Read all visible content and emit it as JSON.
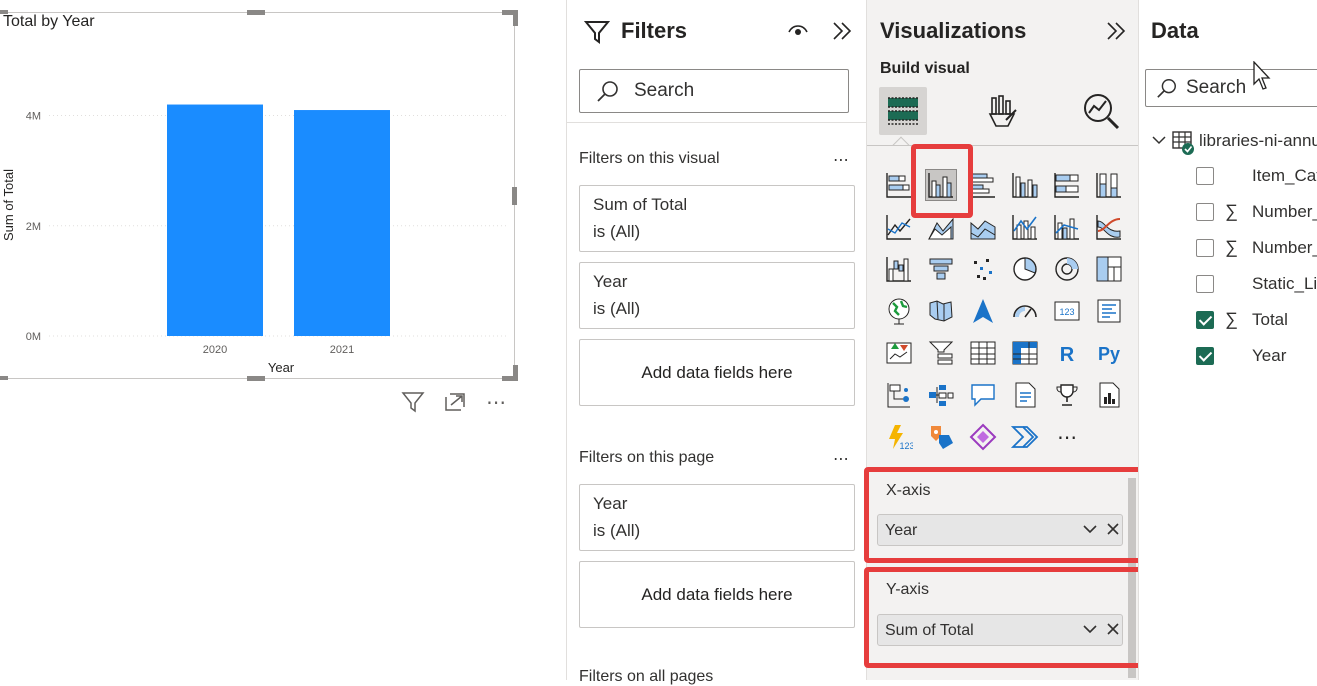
{
  "visual": {
    "title": "Total by Year",
    "header_icons": [
      "filter-icon",
      "focus-mode-icon",
      "more-options-icon"
    ],
    "more_glyph": "⋯"
  },
  "chart_data": {
    "type": "bar",
    "categories": [
      "2020",
      "2021"
    ],
    "values": [
      4200000,
      4100000
    ],
    "ylim": [
      0,
      4500000
    ],
    "yticks": [
      {
        "v": 0,
        "label": "0M"
      },
      {
        "v": 2000000,
        "label": "2M"
      },
      {
        "v": 4000000,
        "label": "4M"
      }
    ],
    "xlabel": "Year",
    "ylabel": "Sum of Total",
    "bar_color": "#1a8cff",
    "grid": true
  },
  "filters": {
    "title": "Filters",
    "search_placeholder": "Search",
    "more_glyph": "⋯",
    "on_visual": {
      "label": "Filters on this visual",
      "cards": [
        {
          "name": "Sum of Total",
          "state": "is (All)"
        },
        {
          "name": "Year",
          "state": "is (All)"
        }
      ],
      "add_label": "Add data fields here"
    },
    "on_page": {
      "label": "Filters on this page",
      "cards": [
        {
          "name": "Year",
          "state": "is (All)"
        }
      ],
      "add_label": "Add data fields here"
    },
    "on_all_pages": {
      "label": "Filters on all pages"
    }
  },
  "visualizations": {
    "title": "Visualizations",
    "subtitle": "Build visual",
    "tabs": [
      "build-visual-tab",
      "format-visual-tab",
      "analytics-tab"
    ],
    "more_glyph": "⋯",
    "selected_visual": "clustered-column-chart",
    "wells": [
      {
        "label": "X-axis",
        "field": "Year"
      },
      {
        "label": "Y-axis",
        "field": "Sum of Total"
      }
    ],
    "glyphs": {
      "r": "R",
      "py": "Py",
      "num": "123",
      "chevron": "∨",
      "close": "✕"
    },
    "accent": "#e63d3d"
  },
  "data": {
    "title": "Data",
    "search_placeholder": "Search",
    "table": {
      "name": "libraries-ni-annual"
    },
    "fields": [
      {
        "name": "Item_Category",
        "sum": false,
        "checked": false
      },
      {
        "name": "Number_of_Items",
        "sum": true,
        "checked": false
      },
      {
        "name": "Number_of_Loans",
        "sum": true,
        "checked": false
      },
      {
        "name": "Static_Library",
        "sum": false,
        "checked": false
      },
      {
        "name": "Total",
        "sum": true,
        "checked": true
      },
      {
        "name": "Year",
        "sum": false,
        "checked": true
      }
    ],
    "sigma": "∑",
    "check_color": "#1c6b54"
  }
}
